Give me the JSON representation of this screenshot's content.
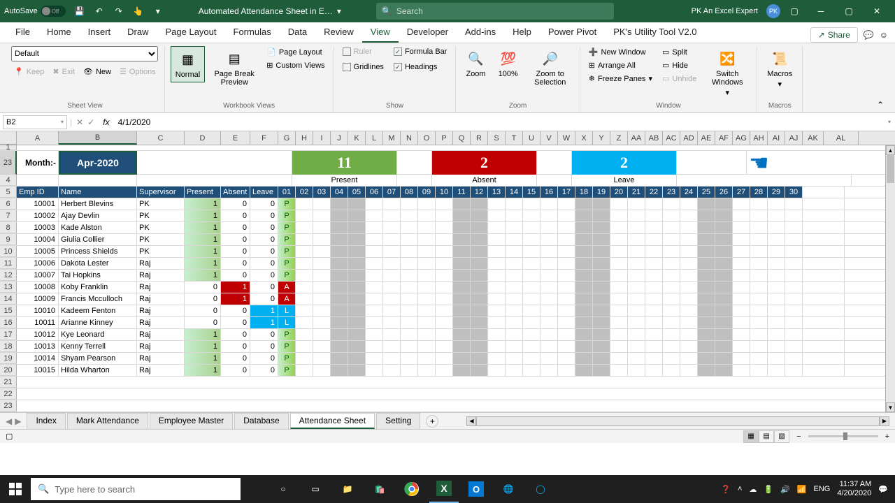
{
  "titlebar": {
    "autosave": "AutoSave",
    "autosave_state": "Off",
    "doc_title": "Automated Attendance Sheet in E…",
    "search_placeholder": "Search",
    "user_name": "PK An Excel Expert"
  },
  "tabs": [
    "File",
    "Home",
    "Insert",
    "Draw",
    "Page Layout",
    "Formulas",
    "Data",
    "Review",
    "View",
    "Developer",
    "Add-ins",
    "Help",
    "Power Pivot",
    "PK's Utility Tool V2.0"
  ],
  "active_tab": "View",
  "share": "Share",
  "ribbon": {
    "sheetview": {
      "default": "Default",
      "keep": "Keep",
      "exit": "Exit",
      "new": "New",
      "options": "Options",
      "label": "Sheet View"
    },
    "workbook": {
      "normal": "Normal",
      "pagebreak": "Page Break Preview",
      "pagelayout": "Page Layout",
      "custom": "Custom Views",
      "label": "Workbook Views"
    },
    "show": {
      "ruler": "Ruler",
      "formula": "Formula Bar",
      "gridlines": "Gridlines",
      "headings": "Headings",
      "label": "Show"
    },
    "zoom": {
      "zoom": "Zoom",
      "hundred": "100%",
      "selection": "Zoom to Selection",
      "label": "Zoom"
    },
    "window": {
      "neww": "New Window",
      "arrange": "Arrange All",
      "freeze": "Freeze Panes",
      "split": "Split",
      "hide": "Hide",
      "unhide": "Unhide",
      "switch": "Switch Windows",
      "label": "Window"
    },
    "macros": {
      "macros": "Macros",
      "label": "Macros"
    }
  },
  "namebox": "B2",
  "formula": "4/1/2020",
  "colheaders": [
    "A",
    "B",
    "C",
    "D",
    "E",
    "F",
    "G",
    "H",
    "I",
    "J",
    "K",
    "L",
    "M",
    "N",
    "O",
    "P",
    "Q",
    "R",
    "S",
    "T",
    "U",
    "V",
    "W",
    "X",
    "Y",
    "Z",
    "AA",
    "AB",
    "AC",
    "AD",
    "AE",
    "AF",
    "AG",
    "AH",
    "AI",
    "AJ",
    "AK",
    "AL"
  ],
  "rowheaders": [
    "1",
    "2",
    "3",
    "4",
    "5",
    "6",
    "7",
    "8",
    "9",
    "10",
    "11",
    "12",
    "13",
    "14",
    "15",
    "16",
    "17",
    "18",
    "19",
    "20",
    "21",
    "22",
    "23"
  ],
  "month_label": "Month:-",
  "month_value": "Apr-2020",
  "summary": {
    "present_n": "11",
    "present_l": "Present",
    "absent_n": "2",
    "absent_l": "Absent",
    "leave_n": "2",
    "leave_l": "Leave"
  },
  "headers": {
    "emp": "Emp ID",
    "name": "Name",
    "sup": "Supervisor",
    "pres": "Present",
    "abs": "Absent",
    "lv": "Leave"
  },
  "days": [
    "01",
    "02",
    "03",
    "04",
    "05",
    "06",
    "07",
    "08",
    "09",
    "10",
    "11",
    "12",
    "13",
    "14",
    "15",
    "16",
    "17",
    "18",
    "19",
    "20",
    "21",
    "22",
    "23",
    "24",
    "25",
    "26",
    "27",
    "28",
    "29",
    "30"
  ],
  "weekends": [
    4,
    5,
    11,
    12,
    18,
    19,
    25,
    26
  ],
  "employees": [
    {
      "id": "10001",
      "name": "Herbert Blevins",
      "sup": "PK",
      "p": "1",
      "a": "0",
      "l": "0",
      "d1": "P"
    },
    {
      "id": "10002",
      "name": "Ajay Devlin",
      "sup": "PK",
      "p": "1",
      "a": "0",
      "l": "0",
      "d1": "P"
    },
    {
      "id": "10003",
      "name": "Kade Alston",
      "sup": "PK",
      "p": "1",
      "a": "0",
      "l": "0",
      "d1": "P"
    },
    {
      "id": "10004",
      "name": "Giulia Collier",
      "sup": "PK",
      "p": "1",
      "a": "0",
      "l": "0",
      "d1": "P"
    },
    {
      "id": "10005",
      "name": "Princess Shields",
      "sup": "PK",
      "p": "1",
      "a": "0",
      "l": "0",
      "d1": "P"
    },
    {
      "id": "10006",
      "name": "Dakota Lester",
      "sup": "Raj",
      "p": "1",
      "a": "0",
      "l": "0",
      "d1": "P"
    },
    {
      "id": "10007",
      "name": "Tai Hopkins",
      "sup": "Raj",
      "p": "1",
      "a": "0",
      "l": "0",
      "d1": "P"
    },
    {
      "id": "10008",
      "name": "Koby Franklin",
      "sup": "Raj",
      "p": "0",
      "a": "1",
      "l": "0",
      "d1": "A"
    },
    {
      "id": "10009",
      "name": "Francis Mcculloch",
      "sup": "Raj",
      "p": "0",
      "a": "1",
      "l": "0",
      "d1": "A"
    },
    {
      "id": "10010",
      "name": "Kadeem Fenton",
      "sup": "Raj",
      "p": "0",
      "a": "0",
      "l": "1",
      "d1": "L"
    },
    {
      "id": "10011",
      "name": "Arianne Kinney",
      "sup": "Raj",
      "p": "0",
      "a": "0",
      "l": "1",
      "d1": "L"
    },
    {
      "id": "10012",
      "name": "Kye Leonard",
      "sup": "Raj",
      "p": "1",
      "a": "0",
      "l": "0",
      "d1": "P"
    },
    {
      "id": "10013",
      "name": "Kenny Terrell",
      "sup": "Raj",
      "p": "1",
      "a": "0",
      "l": "0",
      "d1": "P"
    },
    {
      "id": "10014",
      "name": "Shyam Pearson",
      "sup": "Raj",
      "p": "1",
      "a": "0",
      "l": "0",
      "d1": "P"
    },
    {
      "id": "10015",
      "name": "Hilda Wharton",
      "sup": "Raj",
      "p": "1",
      "a": "0",
      "l": "0",
      "d1": "P"
    }
  ],
  "sheets": [
    "Index",
    "Mark Attendance",
    "Employee Master",
    "Database",
    "Attendance Sheet",
    "Setting"
  ],
  "active_sheet": "Attendance Sheet",
  "taskbar": {
    "search_placeholder": "Type here to search",
    "lang": "ENG",
    "time": "11:37 AM",
    "date": "4/20/2020"
  }
}
